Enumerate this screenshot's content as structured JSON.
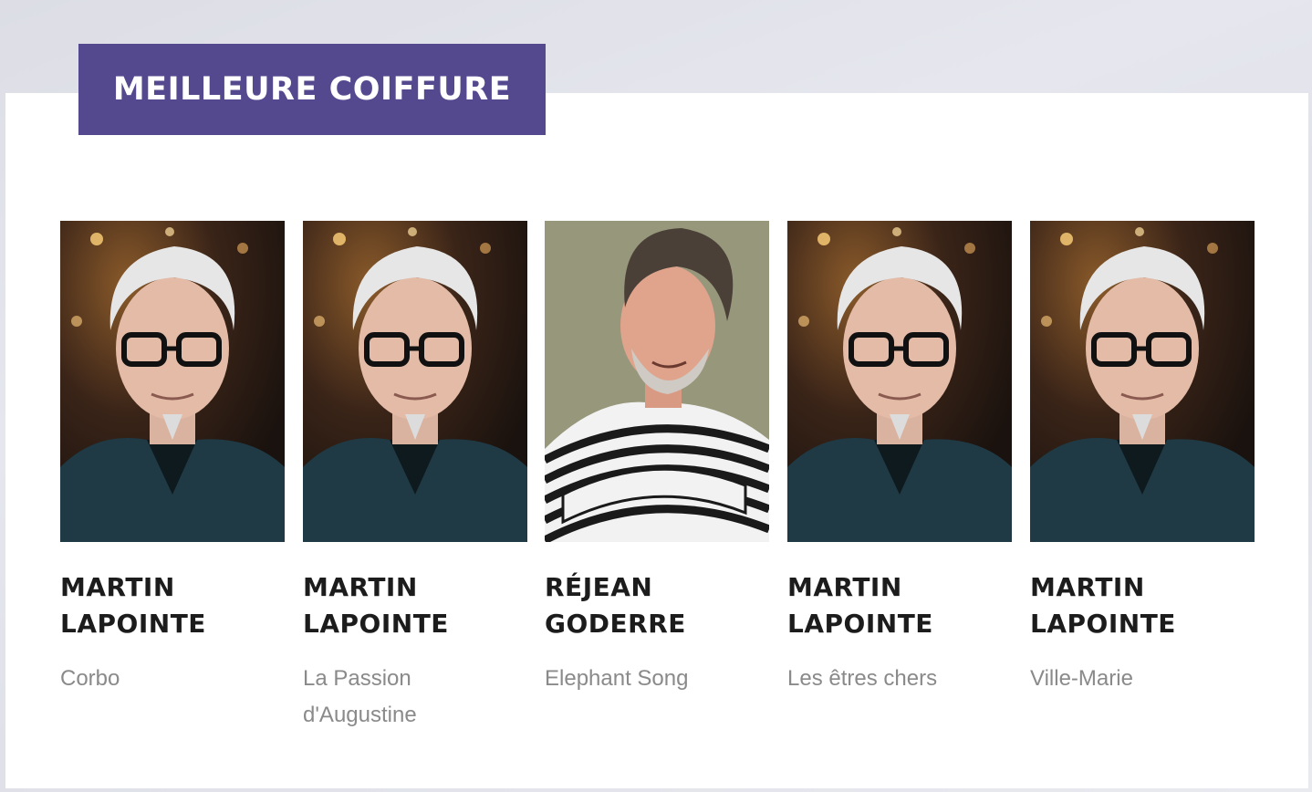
{
  "category": {
    "title": "MEILLEURE COIFFURE",
    "color": "#54498f"
  },
  "nominees": [
    {
      "name": "MARTIN LAPOINTE",
      "film": "Corbo",
      "photo_icon": "portrait-photo"
    },
    {
      "name": "MARTIN LAPOINTE",
      "film": "La Passion d'Augustine",
      "photo_icon": "portrait-photo"
    },
    {
      "name": "RÉJEAN GODERRE",
      "film": "Elephant Song",
      "photo_icon": "portrait-photo"
    },
    {
      "name": "MARTIN LAPOINTE",
      "film": "Les êtres chers",
      "photo_icon": "portrait-photo"
    },
    {
      "name": "MARTIN LAPOINTE",
      "film": "Ville-Marie",
      "photo_icon": "portrait-photo"
    }
  ]
}
